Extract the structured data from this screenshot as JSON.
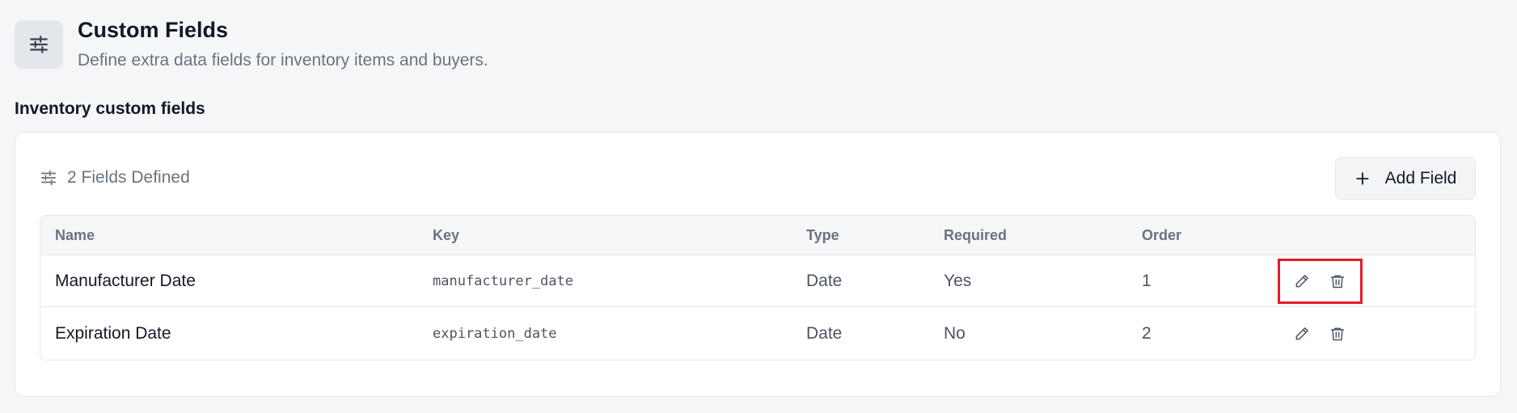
{
  "header": {
    "title": "Custom Fields",
    "subtitle": "Define extra data fields for inventory items and buyers.",
    "icon": "sliders-icon"
  },
  "section": {
    "title": "Inventory custom fields"
  },
  "card": {
    "fields_count_label": "2 Fields Defined",
    "fields_icon": "sliders-icon",
    "add_button_label": "Add Field",
    "add_button_icon": "plus-icon"
  },
  "table": {
    "columns": {
      "name": "Name",
      "key": "Key",
      "type": "Type",
      "required": "Required",
      "order": "Order"
    },
    "rows": [
      {
        "name": "Manufacturer Date",
        "key": "manufacturer_date",
        "type": "Date",
        "required": "Yes",
        "order": "1",
        "highlighted": true
      },
      {
        "name": "Expiration Date",
        "key": "expiration_date",
        "type": "Date",
        "required": "No",
        "order": "2",
        "highlighted": false
      }
    ]
  },
  "colors": {
    "background": "#f5f6f8",
    "highlight": "#e11d2a",
    "text_primary": "#111827",
    "text_muted": "#6b7280"
  }
}
